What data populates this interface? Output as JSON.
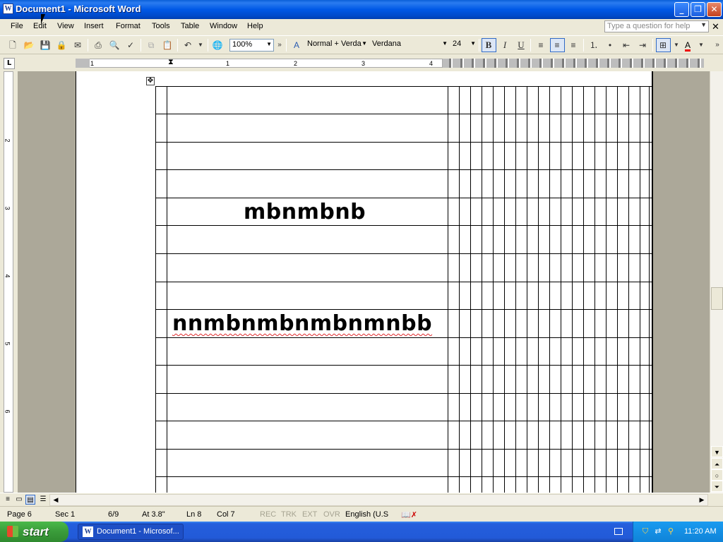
{
  "window": {
    "title": "Document1 - Microsoft Word"
  },
  "menu": [
    "File",
    "Edit",
    "View",
    "Insert",
    "Format",
    "Tools",
    "Table",
    "Window",
    "Help"
  ],
  "help_box": {
    "placeholder": "Type a question for help"
  },
  "toolbar": {
    "zoom": "100%",
    "style": "Normal + Verda",
    "font": "Verdana",
    "size": "24",
    "bold_label": "B",
    "italic_label": "I",
    "underline_label": "U",
    "font_color_label": "A"
  },
  "ruler": {
    "numbers": [
      "1",
      "1",
      "2",
      "3",
      "4"
    ],
    "vnumbers": [
      "2",
      "3",
      "4",
      "5",
      "6"
    ],
    "tab_selector": "L"
  },
  "document": {
    "cell_text_1": "mbnmbnb",
    "cell_text_2": "nnmbnmbnmbnmnbb"
  },
  "status": {
    "page": "Page 6",
    "section": "Sec 1",
    "pages": "6/9",
    "at": "At 3.8\"",
    "line": "Ln 8",
    "col": "Col 7",
    "rec": "REC",
    "trk": "TRK",
    "ext": "EXT",
    "ovr": "OVR",
    "language": "English (U.S"
  },
  "taskbar": {
    "start_label": "start",
    "task_button": "Document1 - Microsof...",
    "clock": "11:20 AM"
  },
  "icons": [
    "word-app-icon",
    "minimize-icon",
    "restore-icon",
    "close-icon",
    "new-icon",
    "open-icon",
    "save-icon",
    "permission-icon",
    "print-icon",
    "print-preview-icon",
    "spelling-icon",
    "cut-icon",
    "copy-icon",
    "paste-icon",
    "undo-icon",
    "research-icon",
    "styles-icon",
    "align-left-icon",
    "center-icon",
    "align-right-icon",
    "numbering-icon",
    "bullets-icon",
    "decrease-indent-icon",
    "increase-indent-icon",
    "borders-icon",
    "font-color-icon"
  ],
  "colors": {
    "titlebar": "#0058e6",
    "taskbar": "#245edc",
    "start": "#3a9b3a",
    "spelling_error": "#e0282a"
  }
}
